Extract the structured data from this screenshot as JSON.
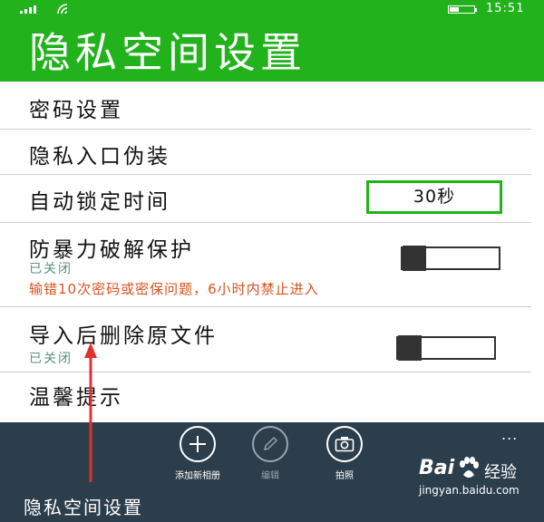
{
  "status_bar": {
    "time": "15:51",
    "signal_icon": "signal-bars-icon",
    "wifi_icon": "wifi-icon",
    "battery_icon": "battery-icon",
    "battery_level": 0.4
  },
  "header": {
    "title": "隐私空间设置"
  },
  "settings": {
    "password": {
      "label": "密码设置"
    },
    "disguise": {
      "label": "隐私入口伪装"
    },
    "auto_lock": {
      "label": "自动锁定时间",
      "value": "30秒"
    },
    "brute_force": {
      "label": "防暴力破解保护",
      "status": "已关闭",
      "warning": "输错10次密码或密保问题，6小时内禁止进入",
      "enabled": false
    },
    "delete_after_import": {
      "label": "导入后删除原文件",
      "status": "已关闭",
      "enabled": false
    },
    "tips": {
      "label": "温馨提示"
    }
  },
  "app_bar": {
    "add_album": {
      "label": "添加新相册",
      "icon": "plus-icon"
    },
    "edit": {
      "label": "编辑",
      "icon": "pencil-icon"
    },
    "photo": {
      "label": "拍照",
      "icon": "camera-icon"
    },
    "more": "..."
  },
  "annotation": {
    "caption": "隐私空间设置",
    "arrow_color": "#e03030"
  },
  "watermark": {
    "brand_part1": "Bai",
    "brand_part2": "经验",
    "url": "jingyan.baidu.com"
  },
  "colors": {
    "accent": "#21b21c",
    "app_bar_bg": "#2c3e4c",
    "warning": "#d9531e",
    "status_text": "#5a8f85"
  }
}
